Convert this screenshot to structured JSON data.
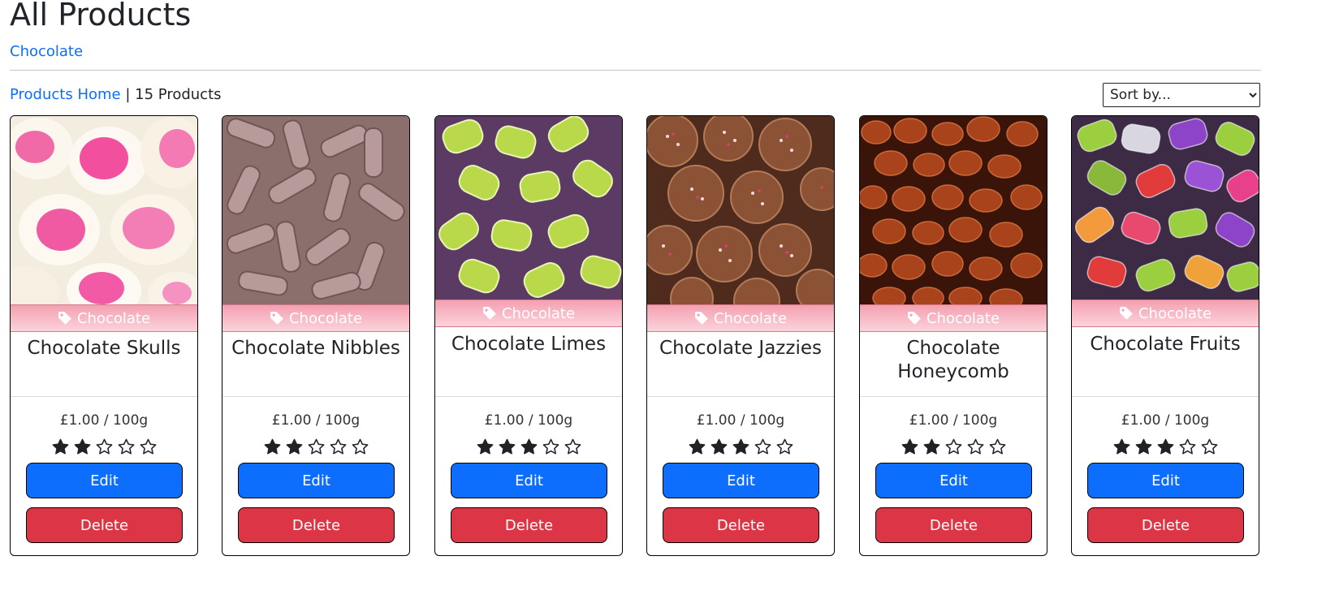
{
  "page": {
    "title": "All Products",
    "category_link": "Chocolate",
    "products_home_label": "Products Home",
    "separator": "|",
    "product_count": "15 Products",
    "sort_placeholder": "Sort by..."
  },
  "colors": {
    "link": "#0d6efd",
    "edit_button": "#0d6efd",
    "delete_button": "#dc3545",
    "category_strip": "#f4a0b1"
  },
  "products": [
    {
      "name": "Chocolate Skulls",
      "category": "Chocolate",
      "price": "£1.00 / 100g",
      "rating": 2,
      "max_rating": 5,
      "edit_label": "Edit",
      "delete_label": "Delete",
      "image_icon": "pink-white-skull-sweets"
    },
    {
      "name": "Chocolate Nibbles",
      "category": "Chocolate",
      "price": "£1.00 / 100g",
      "rating": 2,
      "max_rating": 5,
      "edit_label": "Edit",
      "delete_label": "Delete",
      "image_icon": "cocoa-dusted-nibbles"
    },
    {
      "name": "Chocolate Limes",
      "category": "Chocolate",
      "price": "£1.00 / 100g",
      "rating": 3,
      "max_rating": 5,
      "edit_label": "Edit",
      "delete_label": "Delete",
      "image_icon": "wrapped-lime-sweets"
    },
    {
      "name": "Chocolate Jazzies",
      "category": "Chocolate",
      "price": "£1.00 / 100g",
      "rating": 3,
      "max_rating": 5,
      "edit_label": "Edit",
      "delete_label": "Delete",
      "image_icon": "sprinkle-chocolate-discs"
    },
    {
      "name": "Chocolate Honeycomb",
      "category": "Chocolate",
      "price": "£1.00 / 100g",
      "rating": 2,
      "max_rating": 5,
      "edit_label": "Edit",
      "delete_label": "Delete",
      "image_icon": "chocolate-covered-pieces"
    },
    {
      "name": "Chocolate Fruits",
      "category": "Chocolate",
      "price": "£1.00 / 100g",
      "rating": 3,
      "max_rating": 5,
      "edit_label": "Edit",
      "delete_label": "Delete",
      "image_icon": "wrapped-fruit-sweets"
    }
  ]
}
